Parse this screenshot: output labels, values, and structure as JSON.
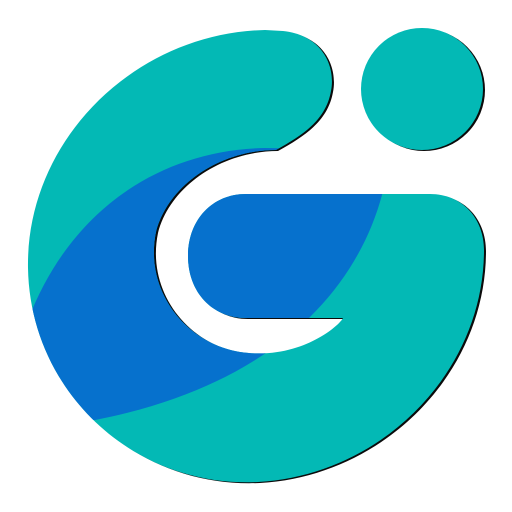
{
  "logo": {
    "icon": "g-letter-logo-icon",
    "colors": {
      "background": "#ffffff",
      "teal": "#03b9b5",
      "blue": "#0671cd",
      "outline": "#0b0b0b"
    }
  }
}
